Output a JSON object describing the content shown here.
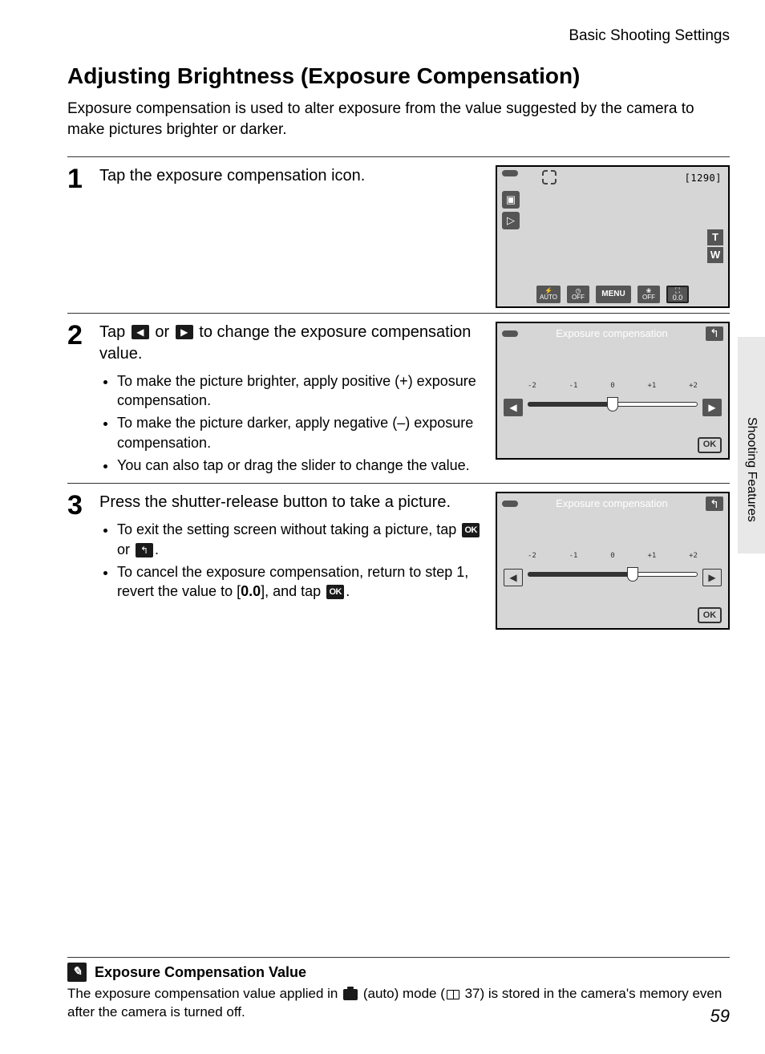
{
  "header": {
    "section": "Basic Shooting Settings"
  },
  "title": "Adjusting Brightness (Exposure Compensation)",
  "intro": "Exposure compensation is used to alter exposure from the value suggested by the camera to make pictures brighter or darker.",
  "side_label": "Shooting Features",
  "page_number": "59",
  "steps": {
    "s1": {
      "num": "1",
      "head": "Tap the exposure compensation icon."
    },
    "s2": {
      "num": "2",
      "head_pre": "Tap ",
      "head_mid": " or ",
      "head_post": " to change the exposure compensation value.",
      "bul1": "To make the picture brighter, apply positive (+) exposure compensation.",
      "bul2": "To make the picture darker, apply negative (–) exposure compensation.",
      "bul3": "You can also tap or drag the slider to change the value."
    },
    "s3": {
      "num": "3",
      "head": "Press the shutter-release button to take a picture.",
      "bul1_pre": "To exit the setting screen without taking a picture, tap ",
      "bul1_mid": " or ",
      "bul1_post": ".",
      "bul2_pre": "To cancel the exposure compensation, return to step 1, revert the value to [",
      "bul2_val": "0.0",
      "bul2_mid": "], and tap ",
      "bul2_post": "."
    }
  },
  "lcd": {
    "counter": "[1290]",
    "tw_t": "T",
    "tw_w": "W",
    "bar_auto": "AUTO",
    "bar_off": "OFF",
    "bar_menu": "MENU",
    "exp_title": "Exposure compensation",
    "ok": "OK",
    "ticks": [
      "-2",
      "-1",
      "0",
      "+1",
      "+2"
    ]
  },
  "footnote": {
    "heading": "Exposure Compensation Value",
    "text_pre": "The exposure compensation value applied in ",
    "text_mid1": " (auto) mode (",
    "page_ref": " 37",
    "text_post": ") is stored in the camera's memory even after the camera is turned off."
  }
}
